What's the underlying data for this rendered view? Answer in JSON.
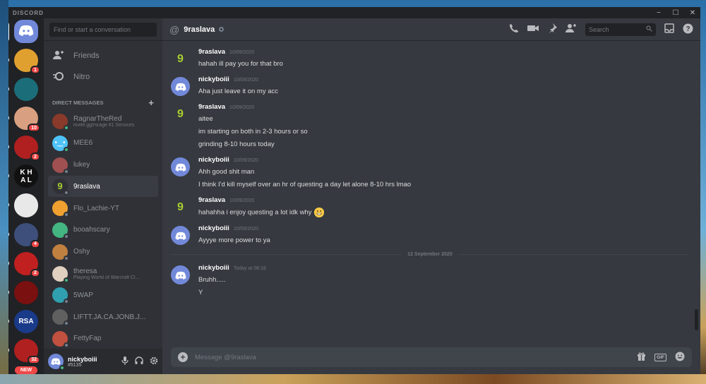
{
  "app": {
    "brand": "DISCORD"
  },
  "window_controls": {
    "minimize": "−",
    "maximize": "☐",
    "close": "✕"
  },
  "guilds": [
    {
      "name": "home",
      "color": "#7289da",
      "badge": ""
    },
    {
      "name": "guild-1",
      "color": "#e0a030",
      "badge": "1"
    },
    {
      "name": "guild-2",
      "color": "#1b6d7a",
      "badge": ""
    },
    {
      "name": "guild-3",
      "color": "#d8a080",
      "badge": "10"
    },
    {
      "name": "guild-4",
      "color": "#b02020",
      "badge": "2"
    },
    {
      "name": "guild-5",
      "color": "#111111",
      "badge": "",
      "text": "K H\nA L"
    },
    {
      "name": "guild-6",
      "color": "#e8e8e8",
      "badge": ""
    },
    {
      "name": "guild-7",
      "color": "#3d4f7a",
      "badge": "4"
    },
    {
      "name": "guild-8",
      "color": "#c02020",
      "badge": "2"
    },
    {
      "name": "guild-9",
      "color": "#7a1010",
      "badge": ""
    },
    {
      "name": "guild-10",
      "color": "#1a3a8a",
      "badge": "",
      "text": "RSA"
    },
    {
      "name": "guild-11",
      "color": "#b02020",
      "badge": "32"
    }
  ],
  "new_pill": "NEW",
  "sidebar": {
    "search_placeholder": "Find or start a conversation",
    "friends": "Friends",
    "nitro": "Nitro",
    "dm_header": "DIRECT MESSAGES",
    "dms": [
      {
        "name": "RagnarTheRed",
        "sub": "invite.gg/rsrage #1 Services",
        "color": "#8a3a2a",
        "status": "#43b581"
      },
      {
        "name": "MEE6",
        "sub": "",
        "color": "#4fc3f7",
        "status": "#43b581"
      },
      {
        "name": "lukey",
        "sub": "",
        "color": "#a05050",
        "status": "#747f8d"
      },
      {
        "name": "9raslava",
        "sub": "",
        "color": "#2f3136",
        "status": "#747f8d"
      },
      {
        "name": "Flo_Lachie-YT",
        "sub": "",
        "color": "#f0a030",
        "status": "#747f8d"
      },
      {
        "name": "booahscary",
        "sub": "",
        "color": "#43b581",
        "status": "#747f8d"
      },
      {
        "name": "Oshy",
        "sub": "",
        "color": "#c08040",
        "status": "#747f8d"
      },
      {
        "name": "theresa",
        "sub": "Playing World of Warcraft Cl...",
        "color": "#e0d0c0",
        "status": "#43b581"
      },
      {
        "name": "5WAP",
        "sub": "",
        "color": "#30a0b0",
        "status": "#747f8d"
      },
      {
        "name": "LIFTT.JA.CA.JONB.J...",
        "sub": "",
        "color": "#606060",
        "status": "#747f8d"
      },
      {
        "name": "FettyFap",
        "sub": "",
        "color": "#c05040",
        "status": "#747f8d"
      }
    ]
  },
  "user": {
    "name": "nickyboiii",
    "tag": "#5135"
  },
  "chat": {
    "title": "9raslava",
    "search_placeholder": "Search",
    "messages": [
      {
        "author": "9raslava",
        "time": "10/09/2020",
        "avatar": "9",
        "lines": [
          "hahah ill pay you for that bro"
        ]
      },
      {
        "author": "nickyboiii",
        "time": "10/09/2020",
        "avatar": "discord",
        "lines": [
          "Aha just leave it on my acc"
        ]
      },
      {
        "author": "9raslava",
        "time": "10/09/2020",
        "avatar": "9",
        "lines": [
          "aitee",
          "im starting on both in 2-3 hours or so",
          "grinding 8-10 hours today"
        ]
      },
      {
        "author": "nickyboiii",
        "time": "10/09/2020",
        "avatar": "discord",
        "lines": [
          "Ahh good shit man",
          "I think I'd kill myself over an hr of questing a day let alone 8-10 hrs lmao"
        ]
      },
      {
        "author": "9raslava",
        "time": "10/09/2020",
        "avatar": "9",
        "lines": [
          "hahahha i enjoy questing a lot idk why"
        ],
        "emoji": true
      },
      {
        "author": "nickyboiii",
        "time": "10/09/2020",
        "avatar": "discord",
        "lines": [
          "Ayyye more power to ya"
        ]
      }
    ],
    "divider": "12 September 2020",
    "last_message": {
      "author": "nickyboiii",
      "time": "Today at 08:18",
      "lines": [
        "Bruhh.....",
        "Y"
      ]
    },
    "composer_placeholder": "Message @9raslava",
    "gif_label": "GIF"
  }
}
